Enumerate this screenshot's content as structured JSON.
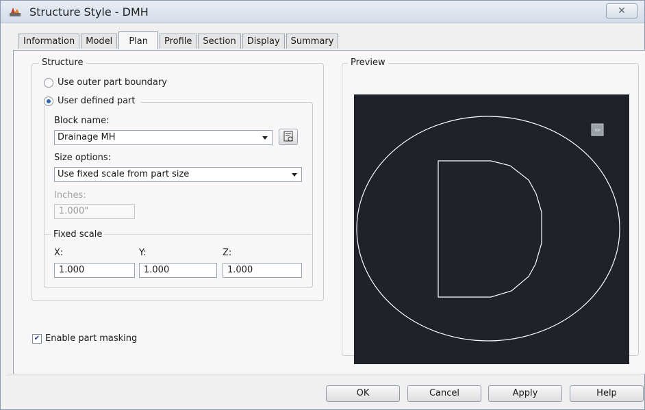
{
  "window": {
    "title": "Structure Style - DMH",
    "close_label": "✕"
  },
  "tabs": [
    {
      "label": "Information"
    },
    {
      "label": "Model"
    },
    {
      "label": "Plan",
      "active": true
    },
    {
      "label": "Profile"
    },
    {
      "label": "Section"
    },
    {
      "label": "Display"
    },
    {
      "label": "Summary"
    }
  ],
  "structure": {
    "group_label": "Structure",
    "option_outer": "Use outer part boundary",
    "option_user": "User defined part",
    "selected": "User defined part",
    "block_name_label": "Block name:",
    "block_name_value": "Drainage MH",
    "size_options_label": "Size options:",
    "size_options_value": "Use fixed scale from part size",
    "inches_label": "Inches:",
    "inches_value": "1.000\"",
    "fixed_scale_label": "Fixed scale",
    "x_label": "X:",
    "y_label": "Y:",
    "z_label": "Z:",
    "x_value": "1.000",
    "y_value": "1.000",
    "z_value": "1.000"
  },
  "preview": {
    "label": "Preview",
    "view_badge": "TOP",
    "background_color": "#1f2329",
    "stroke_color": "#ffffff"
  },
  "masking": {
    "label": "Enable part masking",
    "checked": true
  },
  "buttons": {
    "ok": "OK",
    "cancel": "Cancel",
    "apply": "Apply",
    "help": "Help"
  }
}
